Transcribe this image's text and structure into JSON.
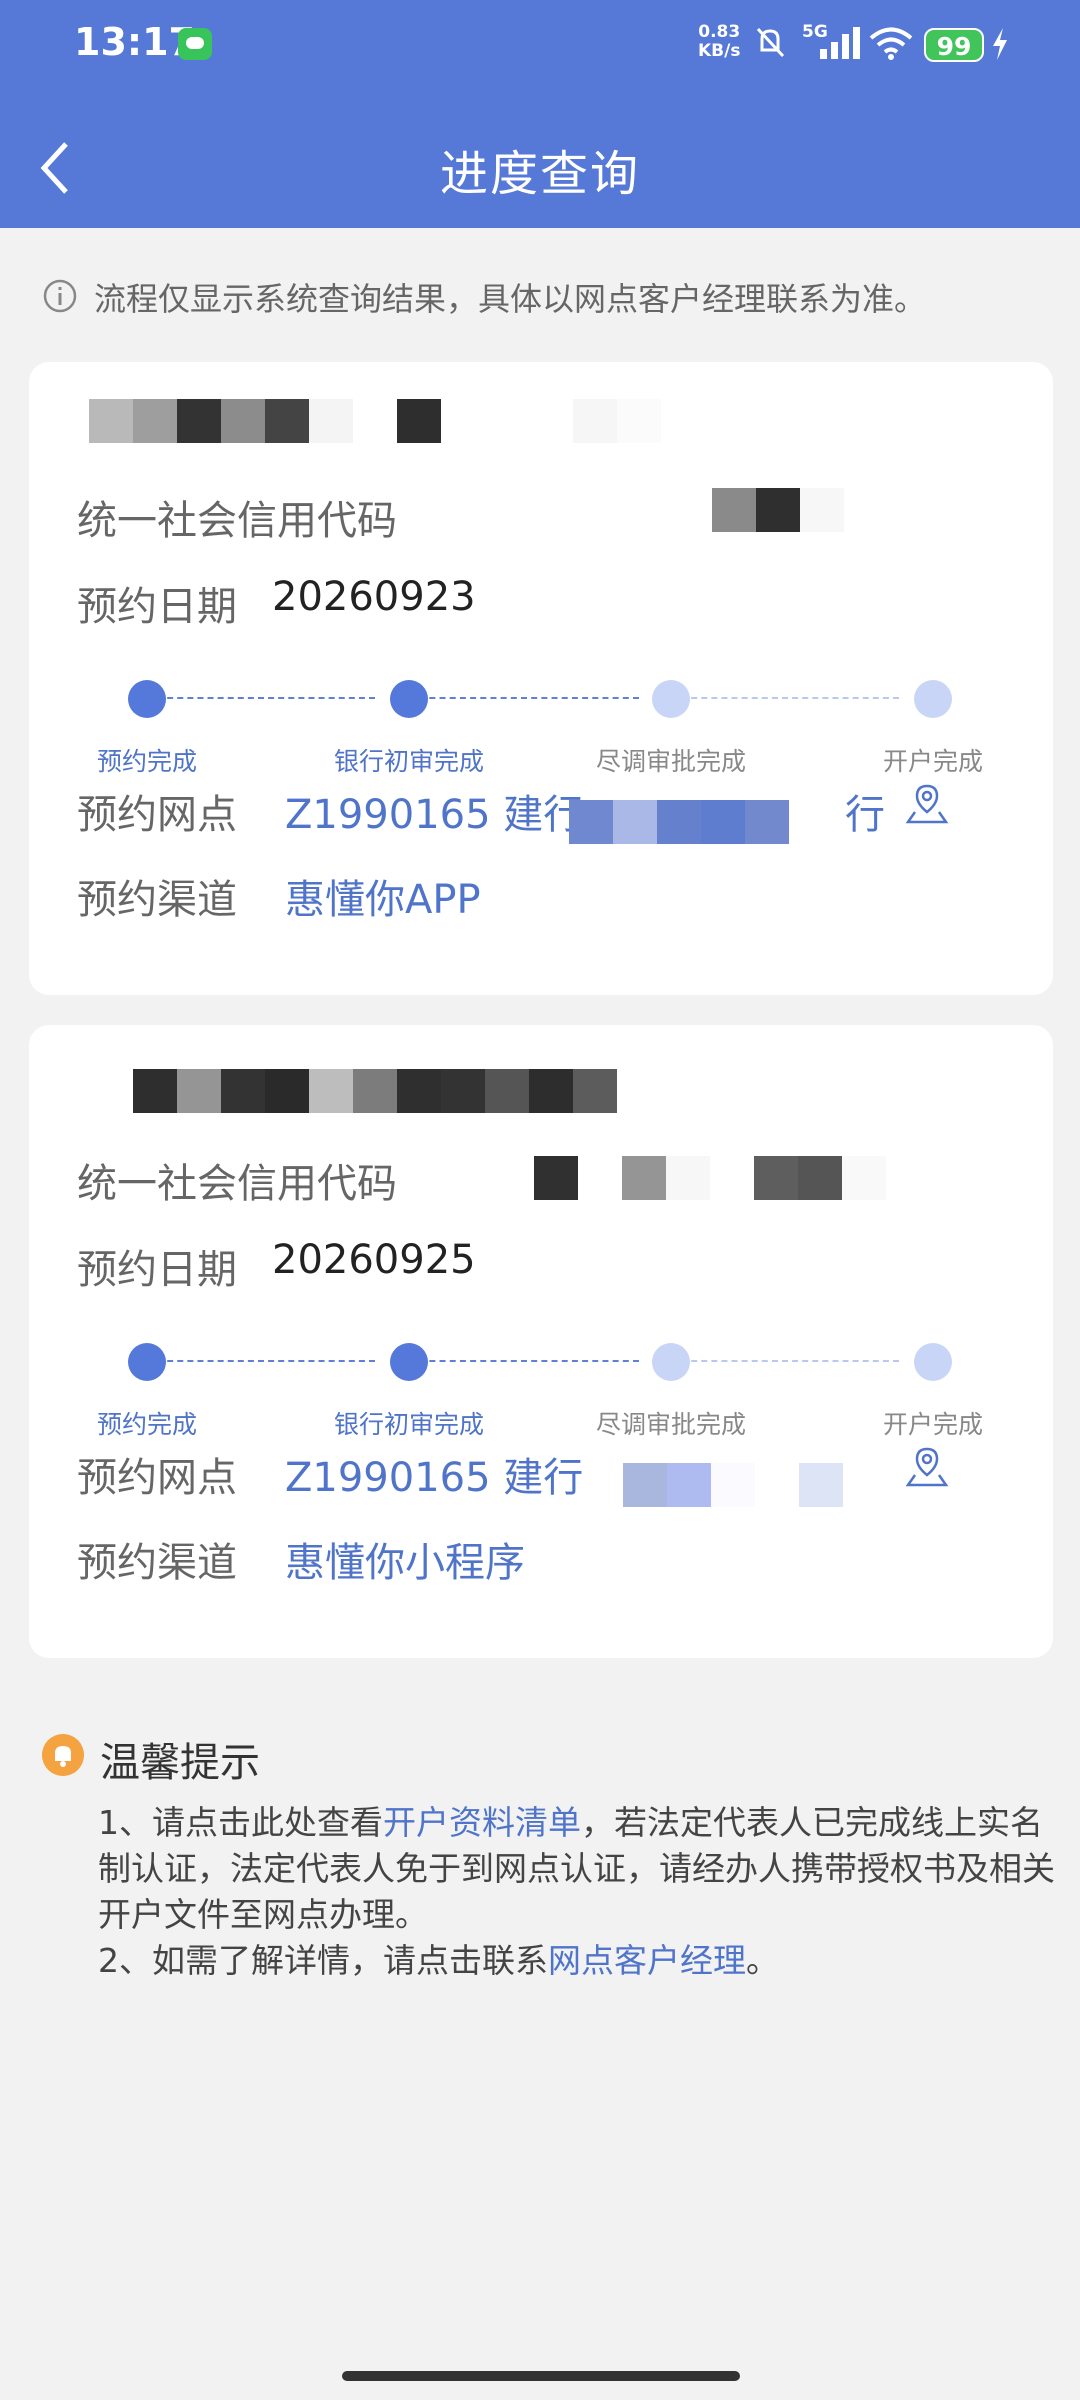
{
  "status_bar": {
    "time": "13:17",
    "net_speed_value": "0.83",
    "net_speed_unit": "KB/s",
    "signal_label": "5G",
    "battery": "99"
  },
  "header": {
    "title": "进度查询"
  },
  "notice": "流程仅显示系统查询结果，具体以网点客户经理联系为准。",
  "labels": {
    "credit_code": "统一社会信用代码",
    "date": "预约日期",
    "branch": "预约网点",
    "channel": "预约渠道"
  },
  "steps": [
    "预约完成",
    "银行初审完成",
    "尽调审批完成",
    "开户完成"
  ],
  "records": [
    {
      "date": "20260923",
      "branch_prefix": "Z1990165 建行",
      "branch_suffix": "行",
      "channel": "惠懂你APP",
      "steps_done": 2
    },
    {
      "date": "20260925",
      "branch_prefix": "Z1990165 建行",
      "branch_suffix": "",
      "channel": "惠懂你小程序",
      "steps_done": 2
    }
  ],
  "tips": {
    "title": "温馨提示",
    "item1_pre": "1、请点击此处查看",
    "item1_link": "开户资料清单",
    "item1_post": "，若法定代表人已完成线上实名制认证，法定代表人免于到网点认证，请经办人携带授权书及相关开户文件至网点办理。",
    "item2_pre": "2、如需了解详情，请点击联系",
    "item2_link": "网点客户经理",
    "item2_post": "。"
  },
  "colors": {
    "header_bg": "#5679d8",
    "accent": "#4f74c9",
    "step_done": "#5479da",
    "step_pending": "#c8d5f7",
    "bell": "#f5a340"
  }
}
